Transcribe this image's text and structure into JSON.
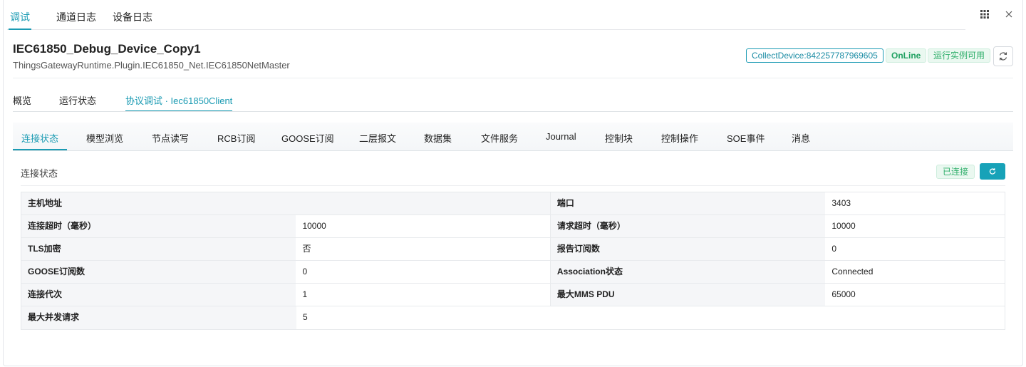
{
  "top_tabs": [
    "调试",
    "通道日志",
    "设备日志"
  ],
  "device": {
    "name": "IEC61850_Debug_Device_Copy1",
    "plugin": "ThingsGatewayRuntime.Plugin.IEC61850_Net.IEC61850NetMaster",
    "collect_badge": "CollectDevice:842257787969605",
    "online_badge": "OnLine",
    "run_badge": "运行实例可用"
  },
  "sec_tabs": [
    "概览",
    "运行状态",
    "协议调试 · Iec61850Client"
  ],
  "third_tabs": [
    "连接状态",
    "模型浏览",
    "节点读写",
    "RCB订阅",
    "GOOSE订阅",
    "二层报文",
    "数据集",
    "文件服务",
    "Journal",
    "控制块",
    "控制操作",
    "SOE事件",
    "消息"
  ],
  "section": {
    "title": "连接状态",
    "status_badge": "已连接"
  },
  "info_rows": [
    {
      "l1": "主机地址",
      "v1": "",
      "l2": "端口",
      "v2": "3403"
    },
    {
      "l1": "连接超时（毫秒）",
      "v1": "10000",
      "l2": "请求超时（毫秒）",
      "v2": "10000"
    },
    {
      "l1": "TLS加密",
      "v1": "否",
      "l2": "报告订阅数",
      "v2": "0"
    },
    {
      "l1": "GOOSE订阅数",
      "v1": "0",
      "l2": "Association状态",
      "v2": "Connected"
    },
    {
      "l1": "连接代次",
      "v1": "1",
      "l2": "最大MMS PDU",
      "v2": "65000"
    },
    {
      "l1": "最大并发请求",
      "v1": "5"
    }
  ],
  "icons": {
    "grid": "grid-icon",
    "close": "close-icon",
    "sync": "sync-icon",
    "refresh": "refresh-icon"
  },
  "colors": {
    "accent": "#1b9bb3",
    "success": "#2fae6a",
    "button": "#17a2b8"
  }
}
